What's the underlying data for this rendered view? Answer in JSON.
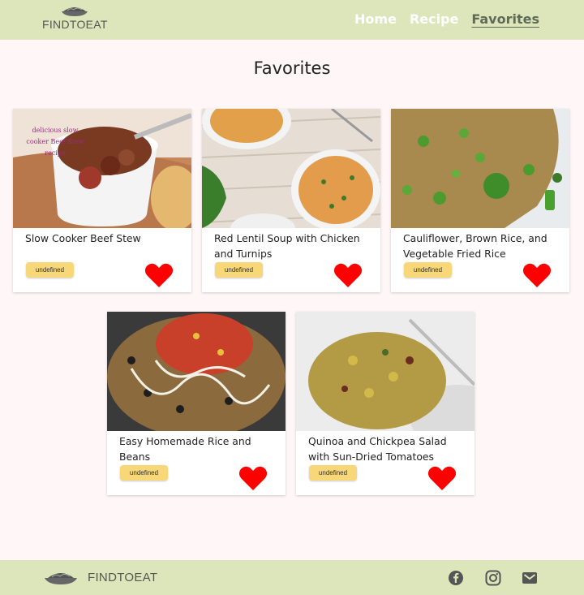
{
  "header": {
    "brand": "FINDTOEAT",
    "nav": [
      {
        "label": "Home"
      },
      {
        "label": "Recipe"
      },
      {
        "label": "Favorites"
      }
    ]
  },
  "page": {
    "title": "Favorites"
  },
  "cards": [
    {
      "title": "Slow Cooker Beef Stew",
      "tag": "undefined",
      "image_text": "delicious slow cooker Beef Stew recipe"
    },
    {
      "title": "Red Lentil Soup with Chicken and Turnips",
      "tag": "undefined"
    },
    {
      "title": "Cauliflower, Brown Rice, and Vegetable Fried Rice",
      "tag": "undefined"
    },
    {
      "title": "Easy Homemade Rice and Beans",
      "tag": "undefined"
    },
    {
      "title": "Quinoa and Chickpea Salad with Sun-Dried Tomatoes and...",
      "tag": "undefined"
    }
  ],
  "footer": {
    "brand": "FINDTOEAT",
    "social": [
      "facebook-icon",
      "instagram-icon",
      "mail-icon"
    ]
  },
  "colors": {
    "header_bg": "#dde6bb",
    "page_bg": "#fff7f7",
    "heart": "#ff0000",
    "tag_bg": "#f7d778",
    "active_nav": "#5f6b56"
  }
}
